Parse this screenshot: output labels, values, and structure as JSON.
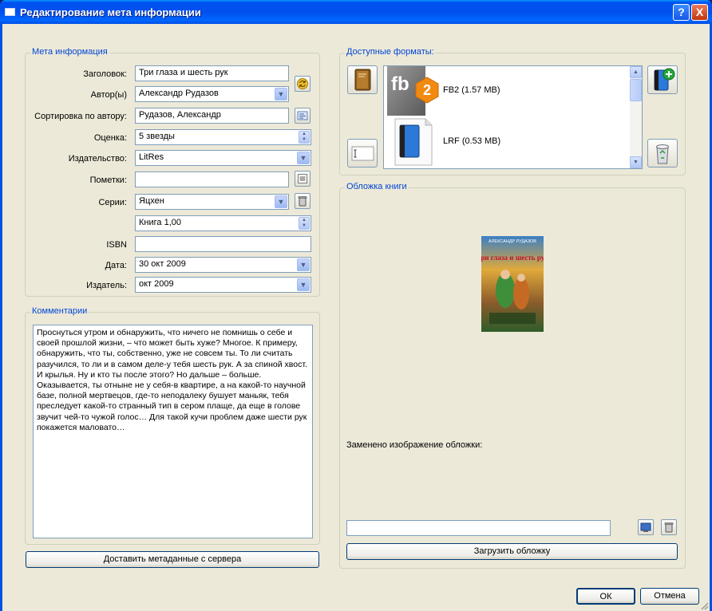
{
  "window": {
    "title": "Редактирование мета информации",
    "help_label": "?",
    "close_label": "X"
  },
  "meta": {
    "group_label": "Мета информация",
    "title_label": "Заголовок:",
    "title_value": "Три глаза и шесть рук",
    "author_label": "Автор(ы)",
    "author_value": "Александр Рудазов",
    "sort_author_label": "Сортировка по автору:",
    "sort_author_value": "Рудазов, Александр",
    "rating_label": "Оценка:",
    "rating_value": "5 звезды",
    "publisher_label": "Издательство:",
    "publisher_value": "LitRes",
    "tags_label": "Пометки:",
    "tags_value": "",
    "series_label": "Серии:",
    "series_value": "Яцхен",
    "series_index_value": "Книга 1,00",
    "isbn_label": "ISBN",
    "isbn_value": "",
    "date_label": "Дата:",
    "date_value": "30 окт 2009",
    "pubdate_label": "Издатель:",
    "pubdate_value": "окт 2009"
  },
  "comments": {
    "group_label": "Комментарии",
    "text": "Проснуться утром и обнаружить, что ничего не помнишь о себе и своей прошлой жизни, – что может быть хуже? Многое. К примеру, обнаружить, что ты, собственно, уже не совсем ты. То ли считать разучился, то ли и в самом деле-у тебя шесть рук. А за спиной хвост. И крылья. Ну и кто ты после этого? Но дальше – больше. Оказывается, ты отныне не у себя-в квартире, а на какой-то научной базе, полной мертвецов, где-то неподалеку бушует маньяк, тебя преследует какой-то странный тип в сером плаще, да еще в голове звучит чей-то чужой голос… Для такой кучи проблем даже шести рук покажется маловато…",
    "fetch_button": "Доставить метаданные с сервера"
  },
  "formats": {
    "group_label": "Доступные форматы:",
    "items": [
      {
        "label": "FB2 (1.57 MB)",
        "icon": "fb2-icon",
        "badge": "2",
        "logo_text": "fb"
      },
      {
        "label": "LRF (0.53 MB)",
        "icon": "lrf-book-icon"
      }
    ]
  },
  "cover": {
    "group_label": "Обложка книги",
    "top_text": "АЛЕКСАНДР РУДАЗОВ",
    "title_text": "Три глаза и шесть рук",
    "status_text": "Заменено изображение обложки:",
    "path_value": "",
    "load_button": "Загрузить обложку"
  },
  "dialog": {
    "ok": "ОК",
    "cancel": "Отмена"
  },
  "colors": {
    "group_label": "#0046d5",
    "titlebar": "#0054e3",
    "face": "#ece9d8"
  }
}
